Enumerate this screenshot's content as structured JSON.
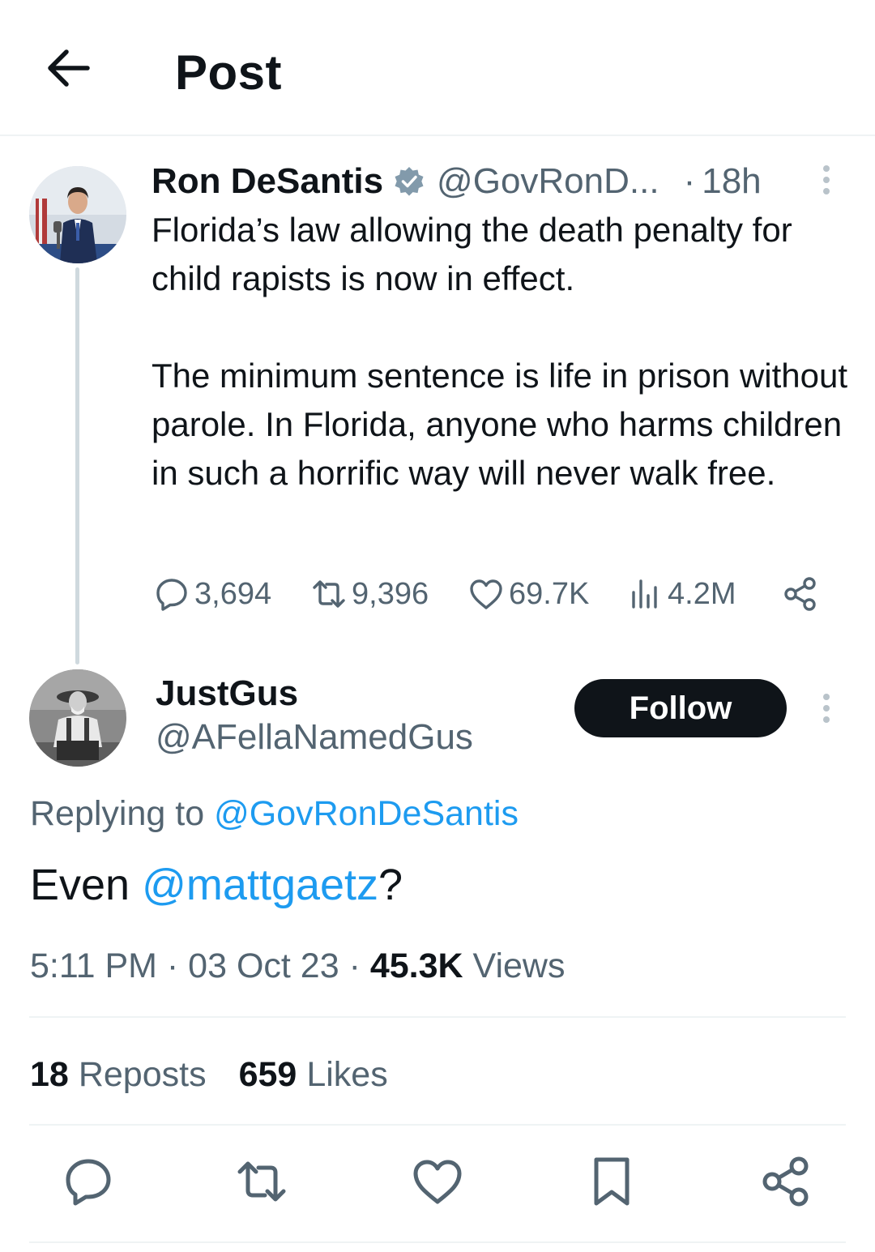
{
  "header": {
    "title": "Post",
    "back_icon": "arrow-left-icon"
  },
  "parent_tweet": {
    "author_name": "Ron DeSantis",
    "author_handle": "@GovRonD...",
    "dot": "·",
    "time": "18h",
    "verified_color": "#829aab",
    "text_paragraphs": [
      "Florida’s law allowing the death penalty for child rapists is now in effect.",
      "The minimum sentence is life in prison without parole. In Florida, anyone who harms children in such a horrific way will never walk free."
    ],
    "stats": {
      "replies": "3,694",
      "reposts": "9,396",
      "likes": "69.7K",
      "views": "4.2M"
    }
  },
  "reply_tweet": {
    "author_name": "JustGus",
    "author_handle": "@AFellaNamedGus",
    "follow_label": "Follow",
    "replying_prefix": "Replying to",
    "replying_to": "@GovRonDeSantis",
    "text_before": "Even",
    "mention": "@mattgaetz",
    "text_after": "?",
    "time": "5:11 PM",
    "date": "03 Oct 23",
    "views_count": "45.3K",
    "views_label": "Views",
    "reposts_count": "18",
    "reposts_label": "Reposts",
    "likes_count": "659",
    "likes_label": "Likes"
  },
  "colors": {
    "link": "#1d9bf0",
    "secondary_text": "#536471",
    "primary_text": "#0f1419",
    "button_bg": "#0f1419"
  }
}
